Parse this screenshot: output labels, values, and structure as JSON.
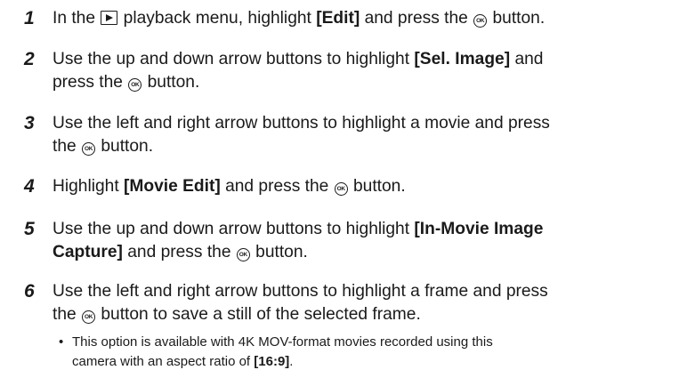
{
  "steps": [
    {
      "num": "1",
      "lines": [
        [
          {
            "t": "In the "
          },
          {
            "icon": "playback-icon"
          },
          {
            "t": " playback menu, highlight "
          },
          {
            "b": "[Edit]"
          },
          {
            "t": " and press the "
          },
          {
            "icon": "ok-icon"
          },
          {
            "t": " button."
          }
        ]
      ]
    },
    {
      "num": "2",
      "lines": [
        [
          {
            "t": "Use the up and down arrow buttons to highlight "
          },
          {
            "b": "[Sel. Image]"
          },
          {
            "t": " and"
          }
        ],
        [
          {
            "t": "press the "
          },
          {
            "icon": "ok-icon"
          },
          {
            "t": " button."
          }
        ]
      ]
    },
    {
      "num": "3",
      "lines": [
        [
          {
            "t": "Use the left and right arrow buttons to highlight a movie and press"
          }
        ],
        [
          {
            "t": "the "
          },
          {
            "icon": "ok-icon"
          },
          {
            "t": " button."
          }
        ]
      ]
    },
    {
      "num": "4",
      "lines": [
        [
          {
            "t": "Highlight "
          },
          {
            "b": "[Movie Edit]"
          },
          {
            "t": " and press the "
          },
          {
            "icon": "ok-icon"
          },
          {
            "t": " button."
          }
        ]
      ]
    },
    {
      "num": "5",
      "lines": [
        [
          {
            "t": "Use the up and down arrow buttons to highlight "
          },
          {
            "b": "[In-Movie Image"
          }
        ],
        [
          {
            "b": "Capture]"
          },
          {
            "t": " and press the "
          },
          {
            "icon": "ok-icon"
          },
          {
            "t": " button."
          }
        ]
      ]
    },
    {
      "num": "6",
      "lines": [
        [
          {
            "t": "Use the left and right arrow buttons to highlight a frame and press"
          }
        ],
        [
          {
            "t": "the "
          },
          {
            "icon": "ok-icon"
          },
          {
            "t": " button to save a still of the selected frame."
          }
        ]
      ]
    }
  ],
  "note": {
    "bullet": "•",
    "lines": [
      [
        {
          "t": "This option is available with 4K MOV-format movies recorded using this"
        }
      ],
      [
        {
          "t": "camera with an aspect ratio of "
        },
        {
          "b": "[16:9]"
        },
        {
          "t": "."
        }
      ]
    ]
  },
  "icons": {
    "ok_label": "OK"
  }
}
